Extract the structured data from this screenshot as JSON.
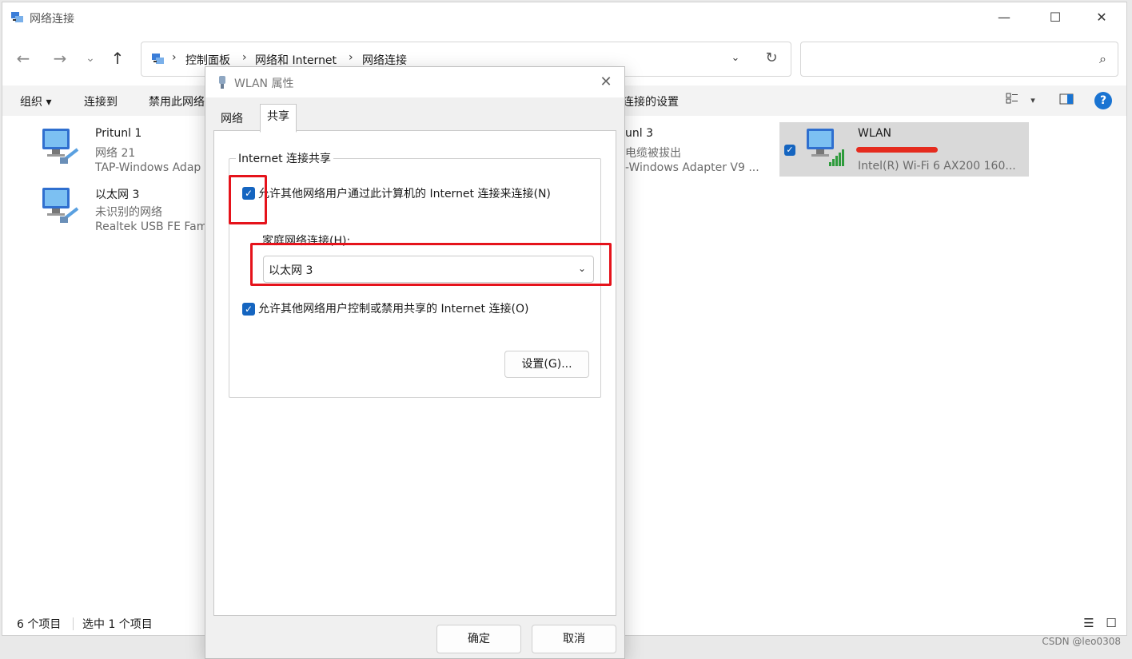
{
  "window": {
    "title": "网络连接",
    "controls": {
      "minimize": "—",
      "maximize": "☐",
      "close": "✕"
    }
  },
  "nav": {
    "back": "←",
    "forward": "→",
    "recent": "⌄",
    "up": "↑",
    "breadcrumb": [
      "控制面板",
      "网络和 Internet",
      "网络连接"
    ],
    "separator": "›",
    "dropdown": "⌄",
    "refresh": "↻",
    "search_placeholder": ""
  },
  "commands": {
    "organize": "组织 ▾",
    "connect_to": "连接到",
    "disable": "禁用此网络",
    "change_settings": "连接的设置",
    "view_menu": "▾"
  },
  "items": [
    {
      "name": "Pritunl 1",
      "line1": "网络 21",
      "line2": "TAP-Windows Adap"
    },
    {
      "name": "以太网 3",
      "line1": "未识别的网络",
      "line2": "Realtek USB FE Fam"
    },
    {
      "name": "unl 3",
      "line1": "电缆被拔出",
      "line2": "-Windows Adapter V9 ..."
    },
    {
      "name": "WLAN",
      "line1": "",
      "line2": "Intel(R) Wi-Fi 6 AX200 160..."
    }
  ],
  "status": {
    "count": "6 个项目",
    "selected": "选中 1 个项目"
  },
  "watermark": "CSDN @leo0308",
  "dialog": {
    "title": "WLAN 属性",
    "close": "✕",
    "tabs": [
      "网络",
      "共享"
    ],
    "group_title": "Internet 连接共享",
    "allow_share_label": "允许其他网络用户通过此计算机的 Internet 连接来连接(N)",
    "allow_share_checked": true,
    "home_conn_label": "家庭网络连接(H):",
    "home_conn_value": "以太网 3",
    "allow_control_label": "允许其他网络用户控制或禁用共享的 Internet 连接(O)",
    "allow_control_checked": true,
    "settings_button": "设置(G)...",
    "ok_button": "确定",
    "cancel_button": "取消"
  },
  "colors": {
    "accent": "#1565c0",
    "highlight_red": "#e5131b",
    "selected_bg": "#d9d9d9"
  },
  "icons": {
    "check": "✓",
    "select_arrow": "⌄",
    "search": "⌕",
    "help": "?"
  }
}
